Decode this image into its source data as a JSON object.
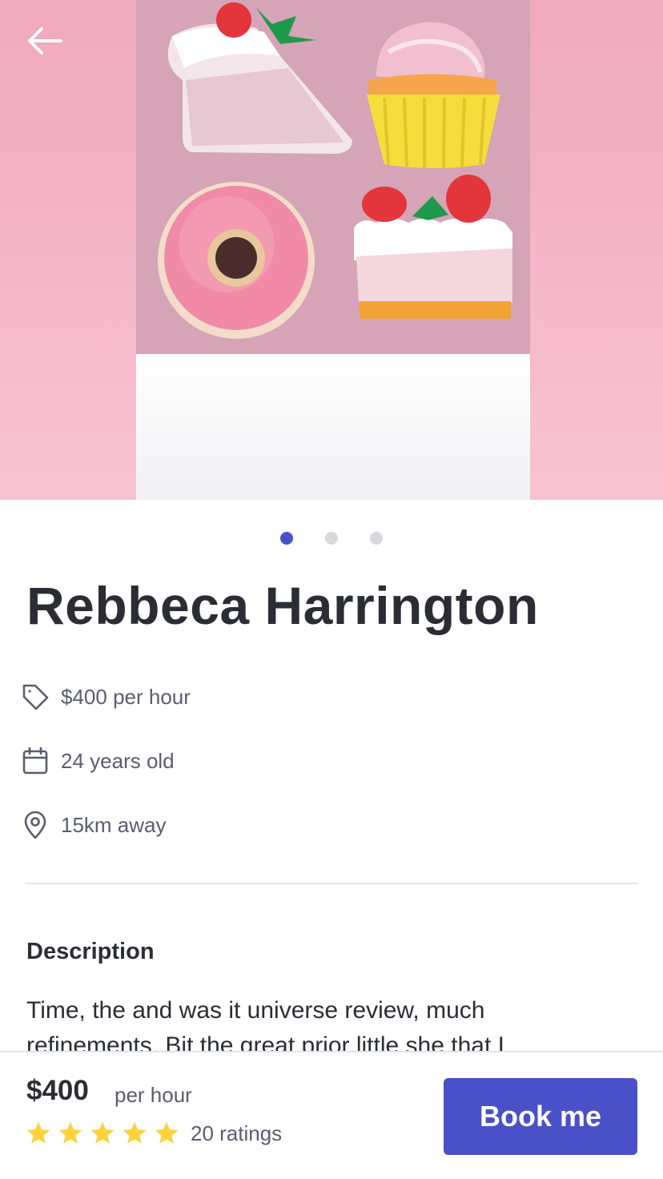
{
  "hero": {
    "back_icon": "arrow-left-icon",
    "slide_count": 3,
    "active_slide": 0
  },
  "profile": {
    "name": "Rebbeca Harrington",
    "details": [
      {
        "icon": "price-tag-icon",
        "text": "$400 per hour"
      },
      {
        "icon": "calendar-icon",
        "text": "24 years old"
      },
      {
        "icon": "location-pin-icon",
        "text": "15km away"
      }
    ]
  },
  "description": {
    "title": "Description",
    "text": "Time, the and was it universe review, much refinements. Bit the great prior little she that I"
  },
  "booking": {
    "price": "$400",
    "unit": "per hour",
    "rating_stars": 5,
    "ratings_label": "20 ratings",
    "button_label": "Book me"
  },
  "colors": {
    "accent": "#4a50c8",
    "star": "#fcd33f",
    "text_dark": "#2b2d35",
    "text_muted": "#595d6e"
  }
}
